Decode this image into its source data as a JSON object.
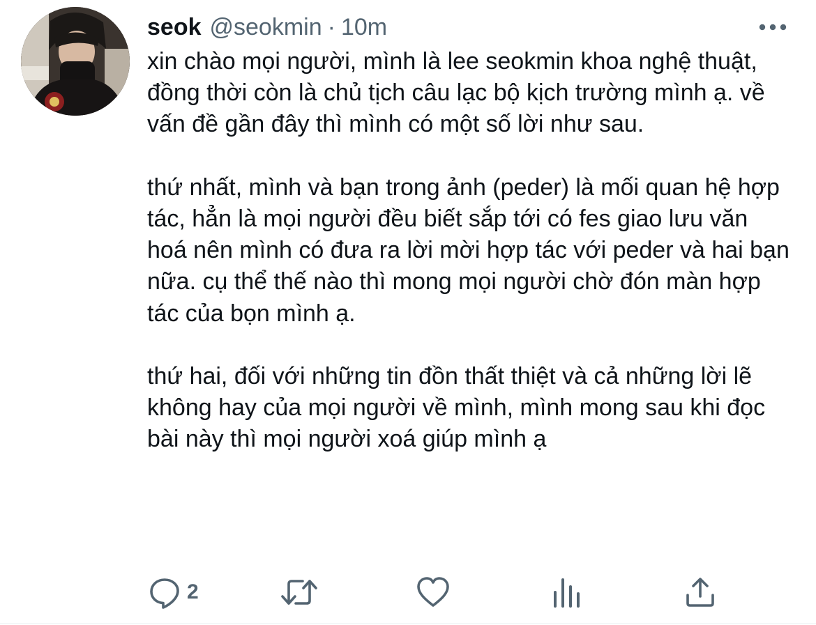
{
  "tweet": {
    "display_name": "seok",
    "handle": "@seokmin",
    "separator": "·",
    "time": "10m",
    "text": "xin chào mọi người, mình là lee seokmin khoa nghệ thuật, đồng thời còn là chủ tịch câu lạc bộ kịch trường mình ạ. về vấn đề gần đây thì mình có một số lời như sau.\n\nthứ nhất, mình và bạn trong ảnh (peder) là mối quan hệ hợp tác, hẳn là mọi người đều biết sắp tới có fes giao lưu văn hoá nên mình có đưa ra lời mời hợp tác với peder và hai bạn nữa. cụ thể thế nào thì mong mọi người chờ đón màn hợp tác của bọn mình ạ.\n\nthứ hai, đối với những tin đồn thất thiệt và cả những lời lẽ không hay của mọi người về mình, mình mong sau khi đọc bài này thì mọi người xoá giúp mình ạ"
  },
  "actions": {
    "reply_count": "2",
    "icons": [
      "reply-icon",
      "retweet-icon",
      "like-icon",
      "views-icon",
      "share-icon"
    ]
  },
  "colors": {
    "text": "#0f1419",
    "secondary": "#536471",
    "icon": "#536471"
  }
}
